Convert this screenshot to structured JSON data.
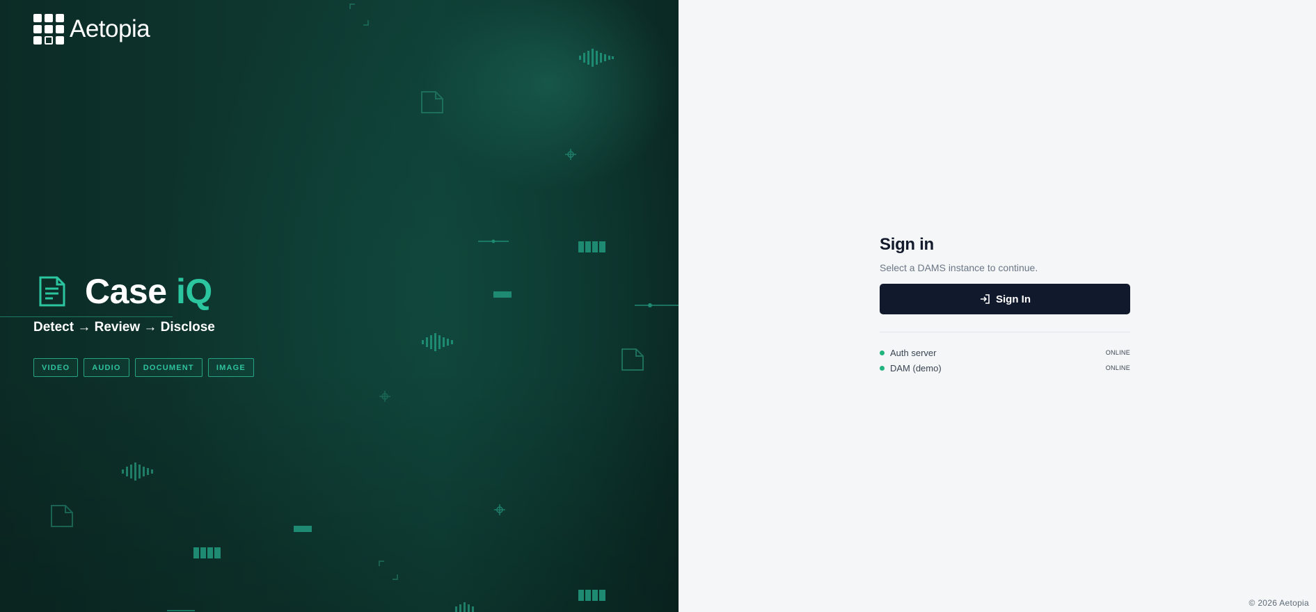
{
  "brand": {
    "name": "Aetopia"
  },
  "product": {
    "name_main": "Case",
    "name_accent": "iQ",
    "tagline": "Detect → Review → Disclose"
  },
  "media_types": [
    "VIDEO",
    "AUDIO",
    "DOCUMENT",
    "IMAGE"
  ],
  "signin": {
    "title": "Sign in",
    "subtitle": "Select a DAMS instance to continue.",
    "button_label": "Sign In"
  },
  "status": [
    {
      "name": "Auth server",
      "value": "ONLINE"
    },
    {
      "name": "DAM (demo)",
      "value": "ONLINE"
    }
  ],
  "footer": "© 2026 Aetopia",
  "colors": {
    "accent": "#2bc5a0",
    "panel_bg": "#0e3830",
    "button_bg": "#111a2c",
    "status_ok": "#22b47f"
  }
}
